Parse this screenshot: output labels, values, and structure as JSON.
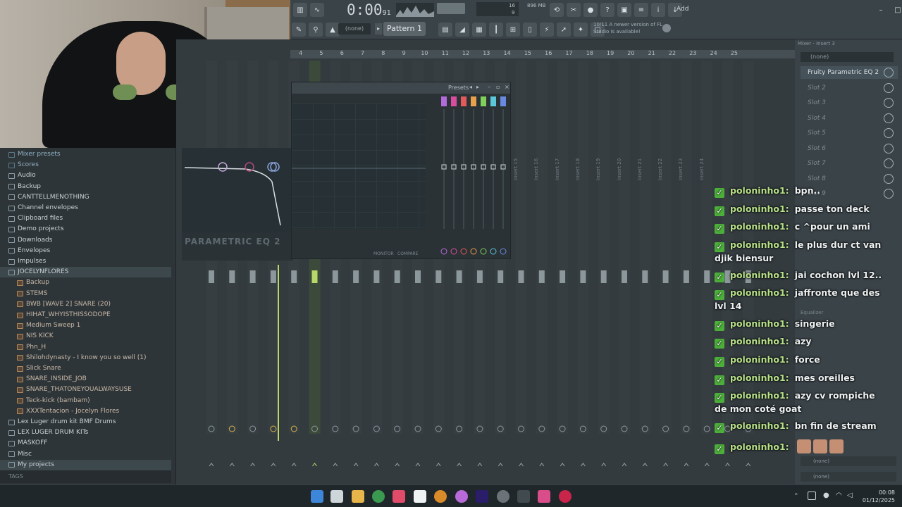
{
  "toolbar": {
    "timecode": "0:00",
    "timecode_small": "91",
    "mem": "896 MB",
    "cpu": "16",
    "voices": "9",
    "pattern": "Pattern 1",
    "none_dropdown": "(none)",
    "notice": "10/11 A newer version of FL Studio is available!",
    "add": "Add"
  },
  "ruler": [
    "4",
    "5",
    "6",
    "7",
    "8",
    "9",
    "10",
    "11",
    "12",
    "13",
    "14",
    "15",
    "16",
    "17",
    "18",
    "19",
    "20",
    "21",
    "22",
    "23",
    "24",
    "25"
  ],
  "browser": {
    "items": [
      {
        "label": "Mixer presets",
        "type": "dim"
      },
      {
        "label": "Scores",
        "type": "dim"
      },
      {
        "label": "Audio",
        "type": "folder"
      },
      {
        "label": "Backup",
        "type": "folder"
      },
      {
        "label": "CANTTELLMENOTHING",
        "type": "folder"
      },
      {
        "label": "Channel envelopes",
        "type": "folder"
      },
      {
        "label": "Clipboard files",
        "type": "folder"
      },
      {
        "label": "Demo projects",
        "type": "folder"
      },
      {
        "label": "Downloads",
        "type": "folder"
      },
      {
        "label": "Envelopes",
        "type": "folder"
      },
      {
        "label": "Impulses",
        "type": "folder"
      },
      {
        "label": "JOCELYNFLORES",
        "type": "open"
      },
      {
        "label": "Backup",
        "type": "subfolder"
      },
      {
        "label": "STEMS",
        "type": "subfolder"
      },
      {
        "label": "BWB [WAVE 2] SNARE (20)",
        "type": "file"
      },
      {
        "label": "HIHAT_WHYISTHISSODOPE",
        "type": "file"
      },
      {
        "label": "Medium Sweep 1",
        "type": "file"
      },
      {
        "label": "NIS KICK",
        "type": "file"
      },
      {
        "label": "Phn_H",
        "type": "file"
      },
      {
        "label": "Shilohdynasty - I know you so well (1)",
        "type": "file"
      },
      {
        "label": "Slick Snare",
        "type": "file"
      },
      {
        "label": "SNARE_INSIDE_JOB",
        "type": "file"
      },
      {
        "label": "SNARE_THATONEYOUALWAYSUSE",
        "type": "file"
      },
      {
        "label": "Teck-kick (bambam)",
        "type": "file"
      },
      {
        "label": "XXXTentacion - Jocelyn Flores",
        "type": "file"
      },
      {
        "label": "Lex Luger drum kit BMF Drums",
        "type": "folder"
      },
      {
        "label": "LEX LUGER DRUM KITs",
        "type": "folder"
      },
      {
        "label": "MASKOFF",
        "type": "folder"
      },
      {
        "label": "Misc",
        "type": "folder"
      },
      {
        "label": "My projects",
        "type": "open"
      },
      {
        "label": "CANTTELLMENOTHING",
        "type": "subfolder"
      }
    ],
    "tags_label": "TAGS"
  },
  "eq": {
    "presets_label": "Presets",
    "brand": "PARAMETRIC EQ 2",
    "monitor": "MONITOR",
    "compare": "COMPARE"
  },
  "insert_labels": [
    "Insert 15",
    "Insert 16",
    "Insert 17",
    "Insert 18",
    "Insert 19",
    "Insert 20",
    "Insert 21",
    "Insert 22",
    "Insert 23",
    "Insert 24"
  ],
  "mixer_panel": {
    "title": "Mixer - Insert 3",
    "preset": "(none)",
    "slots": [
      {
        "label": "Fruity Parametric EQ 2",
        "active": true
      },
      {
        "label": "Slot 2",
        "active": false
      },
      {
        "label": "Slot 3",
        "active": false
      },
      {
        "label": "Slot 4",
        "active": false
      },
      {
        "label": "Slot 5",
        "active": false
      },
      {
        "label": "Slot 6",
        "active": false
      },
      {
        "label": "Slot 7",
        "active": false
      },
      {
        "label": "Slot 8",
        "active": false
      },
      {
        "label": "Slot 9",
        "active": false
      }
    ],
    "equalizer": "Equalizer",
    "bottom_none_1": "(none)",
    "bottom_none_2": "(none)"
  },
  "chat": {
    "messages": [
      {
        "user": "poloninho1:",
        "text": "bpn.."
      },
      {
        "user": "poloninho1:",
        "text": "passe ton deck"
      },
      {
        "user": "poloninho1:",
        "text": "c ^pour un ami"
      },
      {
        "user": "poloninho1:",
        "text": "le plus dur ct van djik biensur"
      },
      {
        "user": "poloninho1:",
        "text": "jai cochon lvl 12.."
      },
      {
        "user": "poloninho1:",
        "text": "jaffronte que des lvl 14"
      },
      {
        "user": "poloninho1:",
        "text": "singerie"
      },
      {
        "user": "poloninho1:",
        "text": "azy"
      },
      {
        "user": "poloninho1:",
        "text": "force"
      },
      {
        "user": "poloninho1:",
        "text": "mes oreilles"
      },
      {
        "user": "poloninho1:",
        "text": "azy cv rompiche de mon coté goat"
      },
      {
        "user": "poloninho1:",
        "text": "bn fin de stream"
      },
      {
        "user": "poloninho1:",
        "text": ""
      }
    ]
  },
  "taskbar": {
    "time": "00:08",
    "date": "01/12/2025"
  }
}
